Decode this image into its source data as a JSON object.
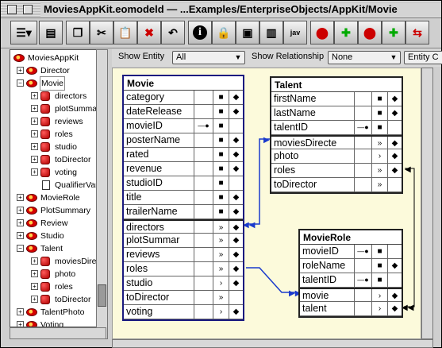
{
  "window": {
    "title": "MoviesAppKit.eomodeld  — ...Examples/EnterpriseObjects/AppKit/Movie"
  },
  "toolbar": {
    "buttons": [
      "outline-view",
      "browser-view",
      "new-entity",
      "cut",
      "paste",
      "delete",
      "undo",
      "inspector",
      "lock",
      "generate-sql",
      "new-attribute",
      "javadoc",
      "add-entity",
      "add-attribute",
      "add-relationship",
      "add-fetch",
      "flatten"
    ]
  },
  "filter": {
    "show_entity_label": "Show Entity",
    "show_entity_value": "All",
    "show_relationship_label": "Show Relationship",
    "show_relationship_value": "None",
    "entity_label": "Entity C"
  },
  "tree": {
    "root": "MoviesAppKit",
    "items": [
      {
        "label": "Director",
        "kind": "entity",
        "level": 1,
        "expanded": false
      },
      {
        "label": "Movie",
        "kind": "entity",
        "level": 1,
        "expanded": true,
        "selected": true
      },
      {
        "label": "directors",
        "kind": "rel",
        "level": 2
      },
      {
        "label": "plotSummary",
        "kind": "rel",
        "level": 2
      },
      {
        "label": "reviews",
        "kind": "rel",
        "level": 2
      },
      {
        "label": "roles",
        "kind": "rel",
        "level": 2
      },
      {
        "label": "studio",
        "kind": "rel",
        "level": 2
      },
      {
        "label": "toDirector",
        "kind": "rel",
        "level": 2
      },
      {
        "label": "voting",
        "kind": "rel",
        "level": 2
      },
      {
        "label": "QualifierVar",
        "kind": "doc",
        "level": 2
      },
      {
        "label": "MovieRole",
        "kind": "entity",
        "level": 1
      },
      {
        "label": "PlotSummary",
        "kind": "entity",
        "level": 1
      },
      {
        "label": "Review",
        "kind": "entity",
        "level": 1
      },
      {
        "label": "Studio",
        "kind": "entity",
        "level": 1
      },
      {
        "label": "Talent",
        "kind": "entity",
        "level": 1,
        "expanded": true
      },
      {
        "label": "moviesDirected",
        "kind": "rel",
        "level": 2
      },
      {
        "label": "photo",
        "kind": "rel",
        "level": 2
      },
      {
        "label": "roles",
        "kind": "rel",
        "level": 2
      },
      {
        "label": "toDirector",
        "kind": "rel",
        "level": 2
      },
      {
        "label": "TalentPhoto",
        "kind": "entity",
        "level": 1
      },
      {
        "label": "Voting",
        "kind": "entity",
        "level": 1
      }
    ]
  },
  "diagram": {
    "movie": {
      "title": "Movie",
      "rows": [
        {
          "name": "category",
          "c1": "",
          "c2": "lock",
          "c3": "dot"
        },
        {
          "name": "dateRelease",
          "c1": "",
          "c2": "lock",
          "c3": "dot"
        },
        {
          "name": "movieID",
          "c1": "key",
          "c2": "lock",
          "c3": ""
        },
        {
          "name": "posterName",
          "c1": "",
          "c2": "lock",
          "c3": "dot"
        },
        {
          "name": "rated",
          "c1": "",
          "c2": "lock",
          "c3": "dot"
        },
        {
          "name": "revenue",
          "c1": "",
          "c2": "lock",
          "c3": "dot"
        },
        {
          "name": "studioID",
          "c1": "",
          "c2": "lock",
          "c3": ""
        },
        {
          "name": "title",
          "c1": "",
          "c2": "lock",
          "c3": "dot"
        },
        {
          "name": "trailerName",
          "c1": "",
          "c2": "lock",
          "c3": "dot"
        },
        {
          "name": "directors",
          "c1": "",
          "c2": "many",
          "c3": "dot"
        },
        {
          "name": "plotSummar",
          "c1": "",
          "c2": "many",
          "c3": "dot"
        },
        {
          "name": "reviews",
          "c1": "",
          "c2": "many",
          "c3": "dot"
        },
        {
          "name": "roles",
          "c1": "",
          "c2": "many",
          "c3": "dot"
        },
        {
          "name": "studio",
          "c1": "",
          "c2": "one",
          "c3": "dot"
        },
        {
          "name": "toDirector",
          "c1": "",
          "c2": "many",
          "c3": ""
        },
        {
          "name": "voting",
          "c1": "",
          "c2": "one",
          "c3": "dot"
        }
      ]
    },
    "talent": {
      "title": "Talent",
      "rows": [
        {
          "name": "firstName",
          "c1": "",
          "c2": "lock",
          "c3": "dot"
        },
        {
          "name": "lastName",
          "c1": "",
          "c2": "lock",
          "c3": "dot"
        },
        {
          "name": "talentID",
          "c1": "key",
          "c2": "lock",
          "c3": ""
        },
        {
          "name": "moviesDirecte",
          "c1": "",
          "c2": "many",
          "c3": "dot"
        },
        {
          "name": "photo",
          "c1": "",
          "c2": "one",
          "c3": "dot"
        },
        {
          "name": "roles",
          "c1": "",
          "c2": "many",
          "c3": "dot"
        },
        {
          "name": "toDirector",
          "c1": "",
          "c2": "many",
          "c3": ""
        }
      ]
    },
    "movierole": {
      "title": "MovieRole",
      "rows": [
        {
          "name": "movieID",
          "c1": "key",
          "c2": "lock",
          "c3": ""
        },
        {
          "name": "roleName",
          "c1": "",
          "c2": "lock",
          "c3": "dot"
        },
        {
          "name": "talentID",
          "c1": "key",
          "c2": "lock",
          "c3": ""
        },
        {
          "name": "movie",
          "c1": "",
          "c2": "one",
          "c3": "dot"
        },
        {
          "name": "talent",
          "c1": "",
          "c2": "one",
          "c3": "dot"
        }
      ]
    }
  },
  "glyphs": {
    "lock": "■",
    "dot": "◆",
    "many": "»",
    "one": "›",
    "key": "—●"
  }
}
